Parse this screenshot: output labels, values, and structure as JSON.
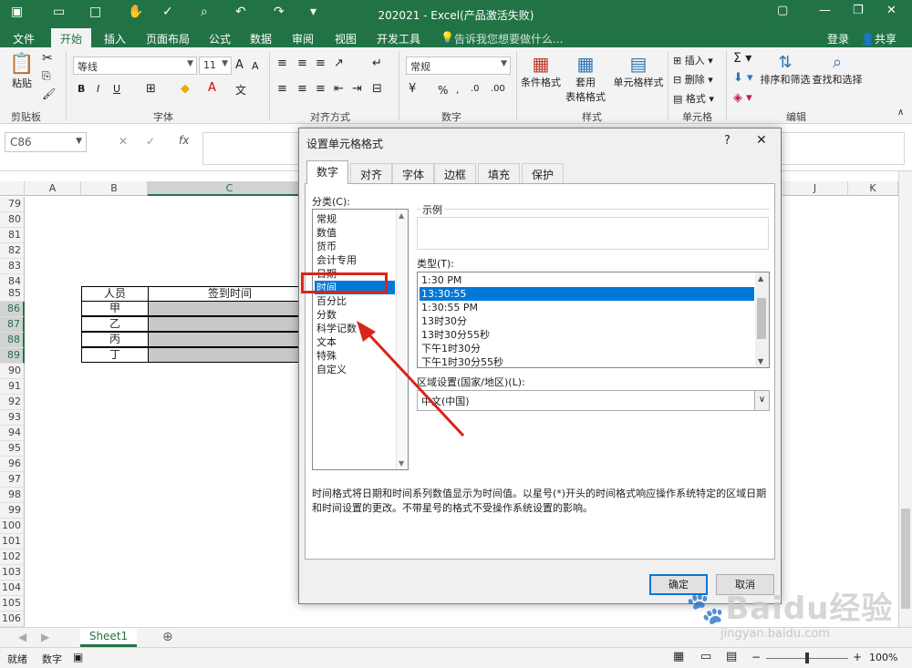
{
  "window": {
    "title": "202021 - Excel(产品激活失败)",
    "login": "登录",
    "share": "共享"
  },
  "tabs": [
    "文件",
    "开始",
    "插入",
    "页面布局",
    "公式",
    "数据",
    "审阅",
    "视图",
    "开发工具"
  ],
  "tell_me": "告诉我您想要做什么...",
  "ribbon": {
    "clipboard": {
      "paste": "粘贴",
      "label": "剪贴板"
    },
    "font": {
      "name": "等线",
      "size": "11",
      "label": "字体",
      "bold": "B",
      "italic": "I",
      "underline": "U"
    },
    "alignment": {
      "label": "对齐方式"
    },
    "number": {
      "format": "常规",
      "label": "数字",
      "percent": "%"
    },
    "styles": {
      "cond": "条件格式",
      "table_a": "套用",
      "table_b": "表格格式",
      "cell": "单元格样式",
      "label": "样式"
    },
    "cells": {
      "insert": "插入",
      "delete": "删除",
      "format": "格式",
      "label": "单元格"
    },
    "editing": {
      "sort": "排序和筛选",
      "find": "查找和选择",
      "label": "编辑"
    }
  },
  "namebox": "C86",
  "formula": {
    "fx": "fx"
  },
  "columns": [
    "A",
    "B",
    "C",
    "J",
    "K"
  ],
  "rows": [
    "79",
    "80",
    "81",
    "82",
    "83",
    "84",
    "85",
    "86",
    "87",
    "88",
    "89",
    "90",
    "91",
    "92",
    "93",
    "94",
    "95",
    "96",
    "97",
    "98",
    "99",
    "100",
    "101",
    "102",
    "103",
    "104",
    "105",
    "106"
  ],
  "table": {
    "header_b": "人员",
    "header_c": "签到时间",
    "people": [
      "甲",
      "乙",
      "丙",
      "丁"
    ]
  },
  "sheet": {
    "name": "Sheet1"
  },
  "status": {
    "ready": "就绪",
    "mode": "数字",
    "zoom": "100%"
  },
  "dialog": {
    "title": "设置单元格格式",
    "help": "?",
    "tabs": [
      "数字",
      "对齐",
      "字体",
      "边框",
      "填充",
      "保护"
    ],
    "category_label": "分类(C):",
    "categories": [
      "常规",
      "数值",
      "货币",
      "会计专用",
      "日期",
      "时间",
      "百分比",
      "分数",
      "科学记数",
      "文本",
      "特殊",
      "自定义"
    ],
    "sample_label": "示例",
    "type_label": "类型(T):",
    "types": [
      "1:30 PM",
      "13:30:55",
      "1:30:55 PM",
      "13时30分",
      "13时30分55秒",
      "下午1时30分",
      "下午1时30分55秒"
    ],
    "locale_label": "区域设置(国家/地区)(L):",
    "locale_value": "中文(中国)",
    "description": "时间格式将日期和时间系列数值显示为时间值。以星号(*)开头的时间格式响应操作系统特定的区域日期和时间设置的更改。不带星号的格式不受操作系统设置的影响。",
    "ok": "确定",
    "cancel": "取消"
  },
  "watermark": {
    "brand": "Baidu经验",
    "url": "jingyan.baidu.com"
  },
  "colors": {
    "excel_green": "#217346",
    "selection_blue": "#0078d7",
    "highlight_red": "#d9241b"
  }
}
